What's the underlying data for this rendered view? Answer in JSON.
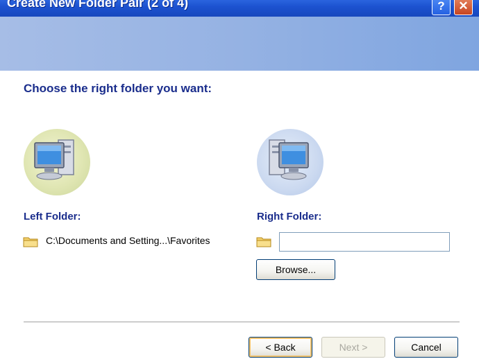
{
  "window": {
    "title": "Create New Folder Pair (2 of 4)",
    "help_glyph": "?",
    "close_glyph": "✕"
  },
  "heading": "Choose the right folder you want:",
  "left": {
    "label": "Left Folder:",
    "path": "C:\\Documents and Setting...\\Favorites",
    "icon": "computer-icon"
  },
  "right": {
    "label": "Right Folder:",
    "input_value": "",
    "browse_label": "Browse...",
    "icon": "computer-icon"
  },
  "buttons": {
    "back": "< Back",
    "next": "Next >",
    "cancel": "Cancel"
  },
  "colors": {
    "accent": "#1a2d8c",
    "titlebar": "#1c52d0"
  }
}
